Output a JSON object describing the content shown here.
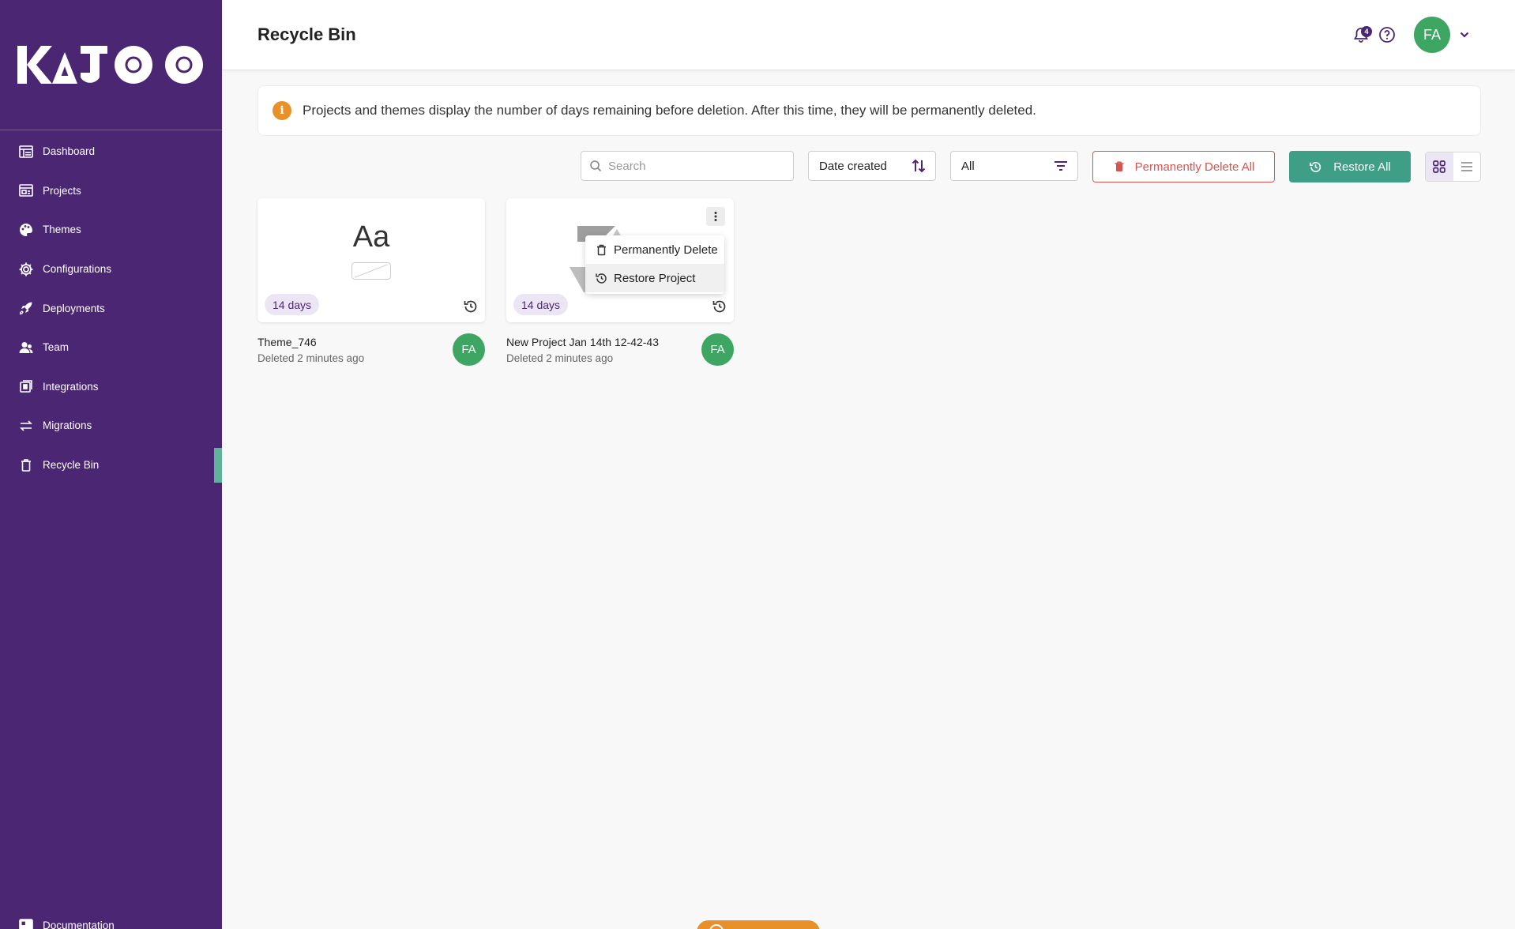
{
  "app": {
    "brand": "KAJOO"
  },
  "sidebar": {
    "items": [
      {
        "label": "Dashboard",
        "icon": "dashboard-icon"
      },
      {
        "label": "Projects",
        "icon": "projects-icon"
      },
      {
        "label": "Themes",
        "icon": "palette-icon"
      },
      {
        "label": "Configurations",
        "icon": "gear-icon"
      },
      {
        "label": "Deployments",
        "icon": "rocket-icon"
      },
      {
        "label": "Team",
        "icon": "team-icon"
      },
      {
        "label": "Integrations",
        "icon": "integrations-icon"
      },
      {
        "label": "Migrations",
        "icon": "migrations-icon"
      },
      {
        "label": "Recycle Bin",
        "icon": "trash-icon",
        "active": true
      }
    ],
    "footer_link": "Documentation"
  },
  "header": {
    "title": "Recycle Bin",
    "notification_count": "4",
    "user_initials": "FA"
  },
  "info_banner": {
    "icon": "i",
    "text": "Projects and themes display the number of days remaining before deletion. After this time, they will be permanently deleted."
  },
  "toolbar": {
    "search_placeholder": "Search",
    "sort_label": "Date created",
    "filter_label": "All",
    "delete_all_label": "Permanently Delete All",
    "restore_all_label": "Restore All",
    "view_mode": "grid"
  },
  "cards": [
    {
      "type": "theme",
      "preview_text": "Aa",
      "days": "14 days",
      "name": "Theme_746",
      "deleted": "Deleted 2 minutes ago",
      "owner_initials": "FA"
    },
    {
      "type": "project",
      "days": "14 days",
      "name": "New Project Jan 14th 12-42-43",
      "deleted": "Deleted 2 minutes ago",
      "owner_initials": "FA"
    }
  ],
  "context_menu": {
    "items": [
      {
        "label": "Permanently Delete",
        "icon": "trash-icon"
      },
      {
        "label": "Restore Project",
        "icon": "restore-icon"
      }
    ]
  },
  "colors": {
    "sidebar": "#4b2673",
    "accent_green": "#3f9e86",
    "danger": "#d9534f",
    "avatar": "#3ea663",
    "info": "#e8902a"
  }
}
